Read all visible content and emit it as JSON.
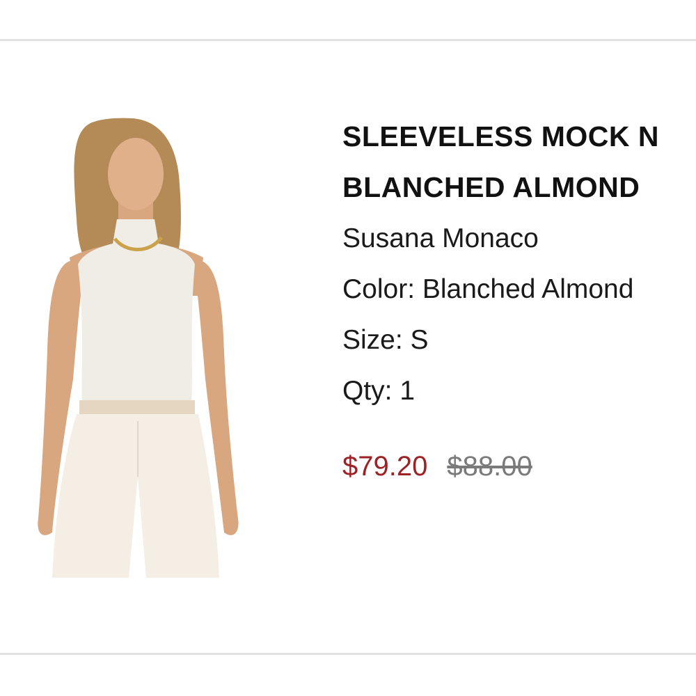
{
  "product": {
    "title_line1": "SLEEVELESS MOCK N",
    "title_line2": "BLANCHED ALMOND",
    "brand": "Susana Monaco",
    "color": "Color: Blanched Almond",
    "size": "Size: S",
    "qty": "Qty: 1",
    "sale_price": "$79.20",
    "original_price": "$88.00",
    "image_icon": "model-photo"
  },
  "colors": {
    "sale": "#9b2226",
    "original": "#7a7a7a",
    "text": "#111111",
    "divider": "#e2e2e2",
    "garment": "#f0ece6",
    "skin": "#d9a77f",
    "hair": "#b48a57"
  }
}
